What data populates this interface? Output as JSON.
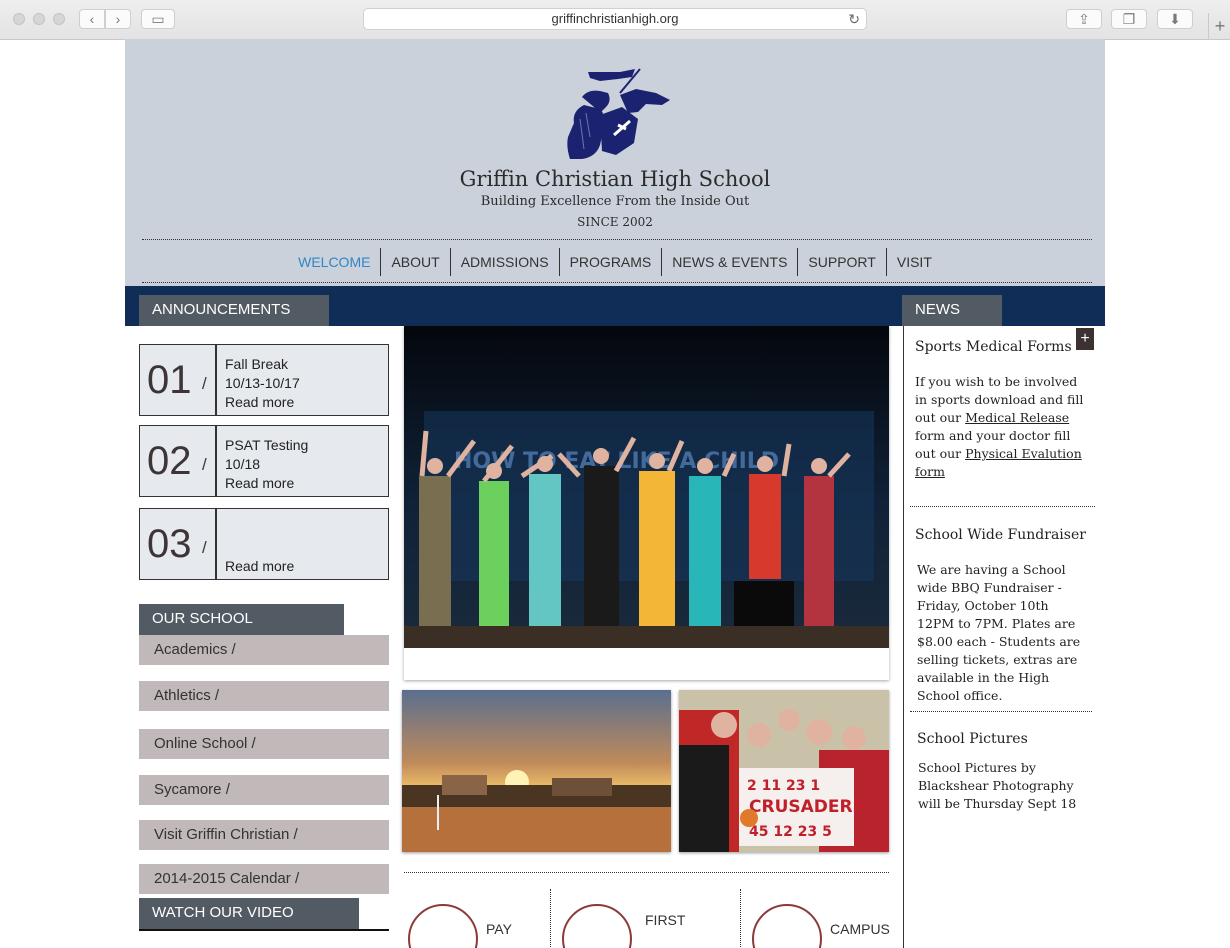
{
  "browser": {
    "url": "griffinchristianhigh.org"
  },
  "header": {
    "school_name": "Griffin Christian High School",
    "tagline": "Building Excellence From the Inside Out",
    "since": "SINCE 2002"
  },
  "nav": {
    "items": [
      {
        "label": "WELCOME",
        "active": true
      },
      {
        "label": "ABOUT"
      },
      {
        "label": "ADMISSIONS"
      },
      {
        "label": "PROGRAMS"
      },
      {
        "label": "NEWS & EVENTS"
      },
      {
        "label": "SUPPORT"
      },
      {
        "label": "VISIT"
      }
    ]
  },
  "announcements": {
    "title": "ANNOUNCEMENTS",
    "slash": "/",
    "read_more": "Read more",
    "items": [
      {
        "num": "01",
        "line1": "Fall Break",
        "line2": "10/13-10/17"
      },
      {
        "num": "02",
        "line1": "PSAT Testing",
        "line2": "10/18"
      },
      {
        "num": "03",
        "line1": "",
        "line2": ""
      }
    ]
  },
  "our_school": {
    "title": "OUR SCHOOL",
    "items": [
      "Academics /",
      "Athletics /",
      "Online School /",
      "Sycamore /",
      "Visit Griffin Christian /",
      "2014-2015 Calendar /"
    ]
  },
  "video": {
    "title": "WATCH OUR VIDEO"
  },
  "quick_links": {
    "pay": "PAY",
    "first": "FIRST",
    "campus": "CAMPUS"
  },
  "news": {
    "title": "NEWS",
    "plus": "+",
    "items": [
      {
        "title": "Sports Medical Forms",
        "text_before": "If you wish to be involved in sports download and fill out our ",
        "link1": "Medical Release",
        "text_mid": " form and your doctor fill out our ",
        "link2": "Physical Evalution form"
      },
      {
        "title": "School Wide Fundraiser",
        "text": "We are having a School wide BBQ Fundraiser - Friday, October 10th 12PM to 7PM. Plates are $8.00 each - Students are selling tickets, extras are available in the High School office."
      },
      {
        "title": "School Pictures",
        "text": "School Pictures by Blackshear Photography will be Thursday Sept 18"
      }
    ]
  },
  "colors": {
    "header_bg": "#cbd1da",
    "band": "#0f2d57",
    "tab": "#525a63",
    "active_nav": "#2f86c9",
    "sidebar_item": "#c0b8b9"
  }
}
